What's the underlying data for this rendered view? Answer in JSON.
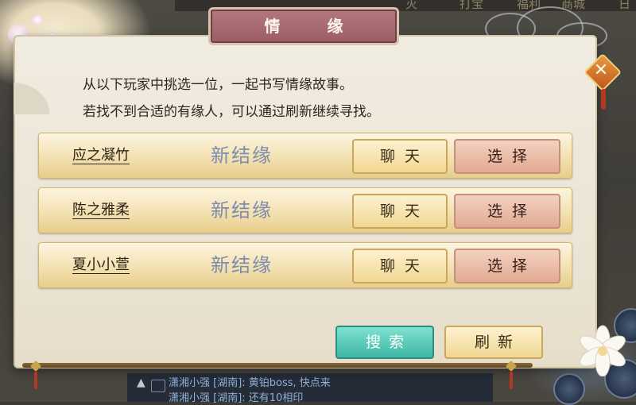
{
  "background": {
    "top_labels": [
      "灭",
      "打宝",
      "福利",
      "商城",
      "日"
    ],
    "chat_lines": [
      "潇湘小强 [湖南]: 黄铂boss, 快点来",
      "潇湘小强 [湖南]: 还有10相印"
    ]
  },
  "dialog": {
    "title": "情 缘",
    "intro_lines": [
      "从以下玩家中挑选一位，一起书写情缘故事。",
      "若找不到合适的有缘人，可以通过刷新继续寻找。"
    ],
    "candidates": [
      {
        "name": "应之凝竹",
        "status": "新结缘",
        "chat_label": "聊天",
        "select_label": "选择"
      },
      {
        "name": "陈之雅柔",
        "status": "新结缘",
        "chat_label": "聊天",
        "select_label": "选择"
      },
      {
        "name": "夏小小萱",
        "status": "新结缘",
        "chat_label": "聊天",
        "select_label": "选择"
      }
    ],
    "search_label": "搜索",
    "refresh_label": "刷新",
    "close_icon": "close-icon"
  },
  "colors": {
    "title_bar": "#a56a70",
    "status_text": "#7d8cad",
    "search_button": "#3fb7a6",
    "chat_button": "#f1d792",
    "select_button": "#e2a993"
  }
}
